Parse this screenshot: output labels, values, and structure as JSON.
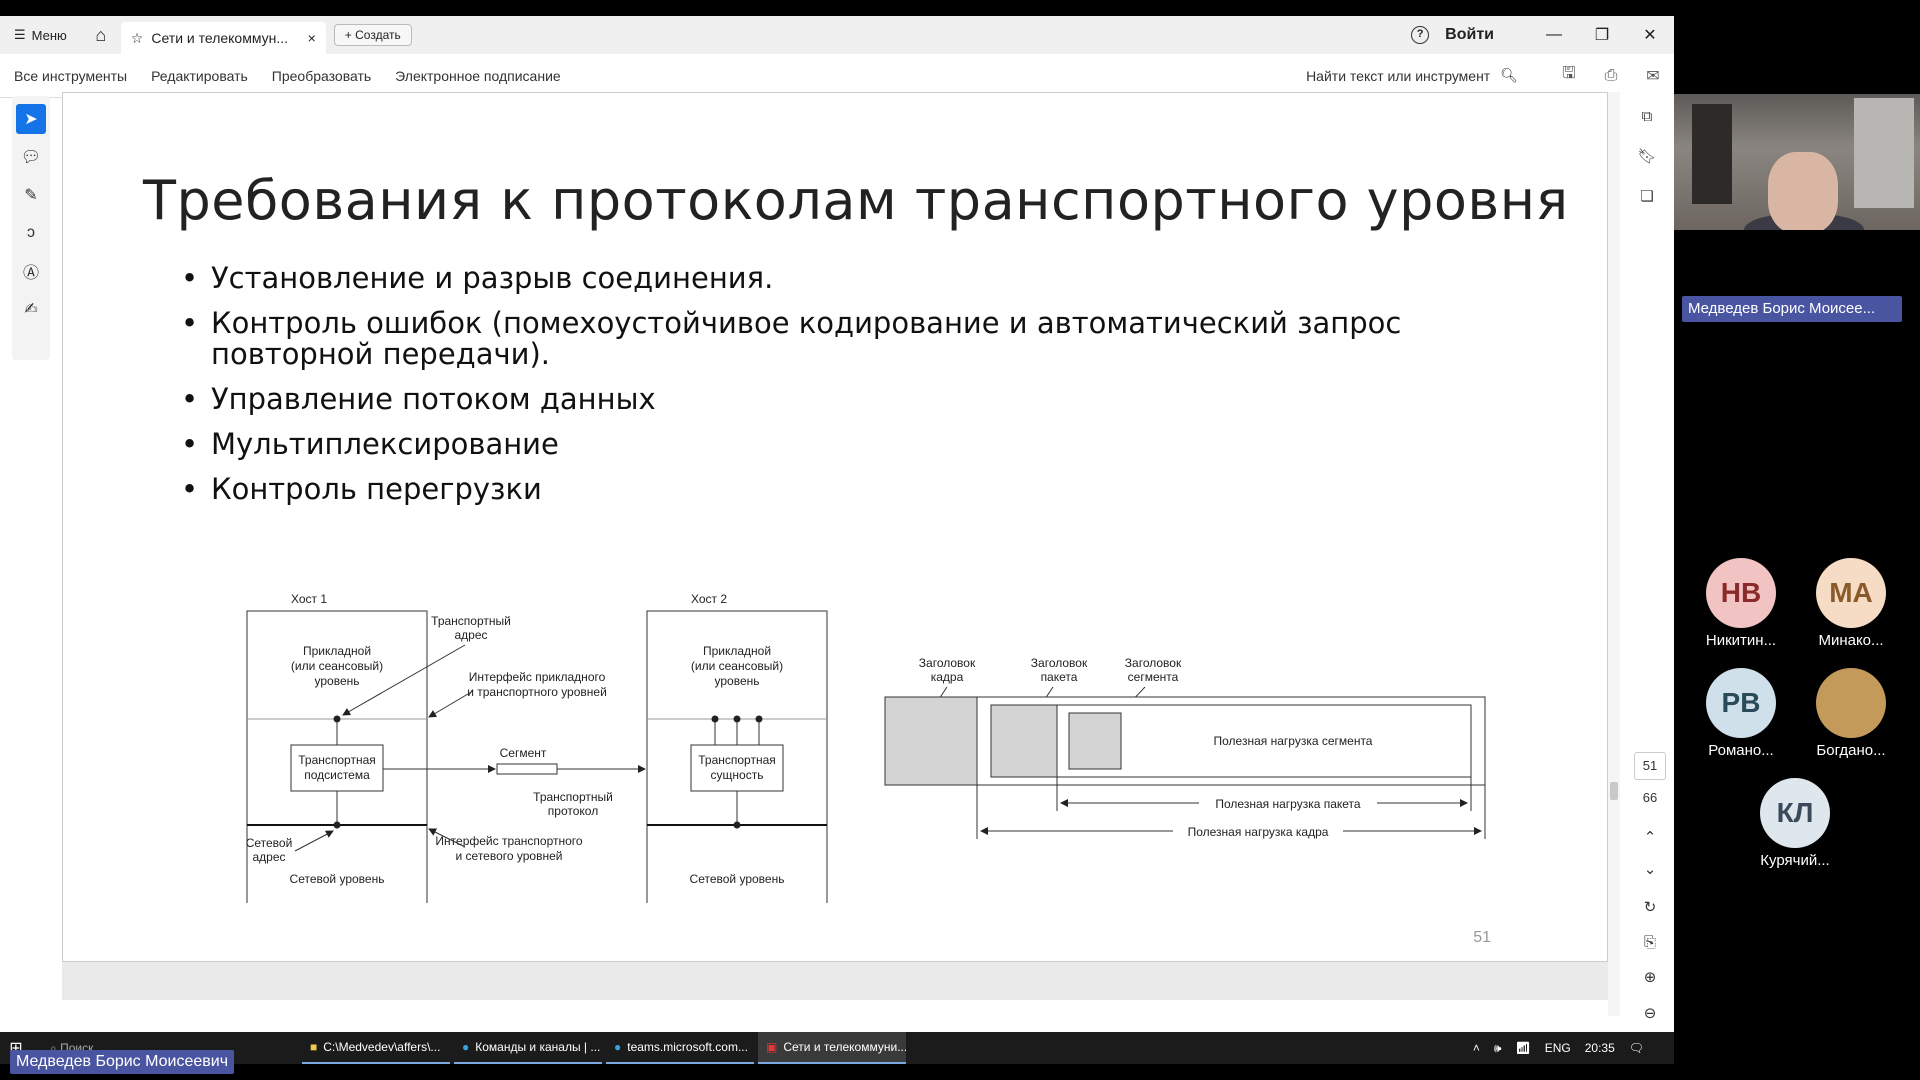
{
  "titlebar": {
    "menu_label": "Меню",
    "tab_title": "Сети и телекоммун...",
    "create_label": "Создать",
    "login_label": "Войти"
  },
  "toolbar": {
    "tools": [
      "Все инструменты",
      "Редактировать",
      "Преобразовать",
      "Электронное подписание"
    ],
    "search_label": "Найти текст или инструмент"
  },
  "slide": {
    "title": "Требования к протоколам транспортного уровня",
    "bullets": [
      "Установление  и разрыв соединения.",
      " Контроль ошибок (помехоустойчивое кодирование и автоматический запрос повторной передачи).",
      "Управление потоком данных",
      "Мультиплексирование",
      "Контроль перегрузки"
    ],
    "page_number": "51",
    "diagram1": {
      "host1": "Хост 1",
      "host2": "Хост 2",
      "app_level_1": "Прикладной",
      "app_level_2": "(или сеансовый)",
      "app_level_3": "уровень",
      "transport_addr_1": "Транспортный",
      "transport_addr_2": "адрес",
      "iface_app_1": "Интерфейс прикладного",
      "iface_app_2": "и транспортного уровней",
      "transport_subsystem_1": "Транспортная",
      "transport_subsystem_2": "подсистема",
      "segment": "Сегмент",
      "transport_entity_1": "Транспортная",
      "transport_entity_2": "сущность",
      "transport_protocol_1": "Транспортный",
      "transport_protocol_2": "протокол",
      "net_addr_1": "Сетевой",
      "net_addr_2": "адрес",
      "iface_net_1": "Интерфейс транспортного",
      "iface_net_2": "и сетевого уровней",
      "net_level": "Сетевой уровень"
    },
    "diagram2": {
      "frame_header_1": "Заголовок",
      "frame_header_2": "кадра",
      "packet_header_1": "Заголовок",
      "packet_header_2": "пакета",
      "segment_header_1": "Заголовок",
      "segment_header_2": "сегмента",
      "segment_payload": "Полезная нагрузка сегмента",
      "packet_payload": "Полезная нагрузка пакета",
      "frame_payload": "Полезная нагрузка кадра"
    }
  },
  "pager": {
    "current": "51",
    "total": "66"
  },
  "taskbar": {
    "search_label": "Поиск",
    "apps": [
      "C:\\Medvedev\\affers\\...",
      "Команды и каналы | ...",
      "teams.microsoft.com...",
      "Сети и телекоммуни..."
    ],
    "lang": "ENG",
    "time": "20:35"
  },
  "meeting": {
    "speaker_name": "Медведев Борис Моисее...",
    "participants": [
      {
        "initials": "НВ",
        "name": "Никитин...",
        "color": "#f2c3c3",
        "text_color": "#8b2a2a"
      },
      {
        "initials": "МА",
        "name": "Минако...",
        "color": "#f6dcc4",
        "text_color": "#8b5a2a"
      },
      {
        "initials": "РВ",
        "name": "Романо...",
        "color": "#cfe0ea",
        "text_color": "#2a4a5a"
      },
      {
        "initials": "",
        "name": "Богдано...",
        "color": "#c49a5a",
        "text_color": "#ffffff"
      },
      {
        "initials": "КЛ",
        "name": "Курячий...",
        "color": "#dfe7ee",
        "text_color": "#3a4a5a"
      }
    ],
    "self_name": "Медведев Борис Моисеевич"
  }
}
